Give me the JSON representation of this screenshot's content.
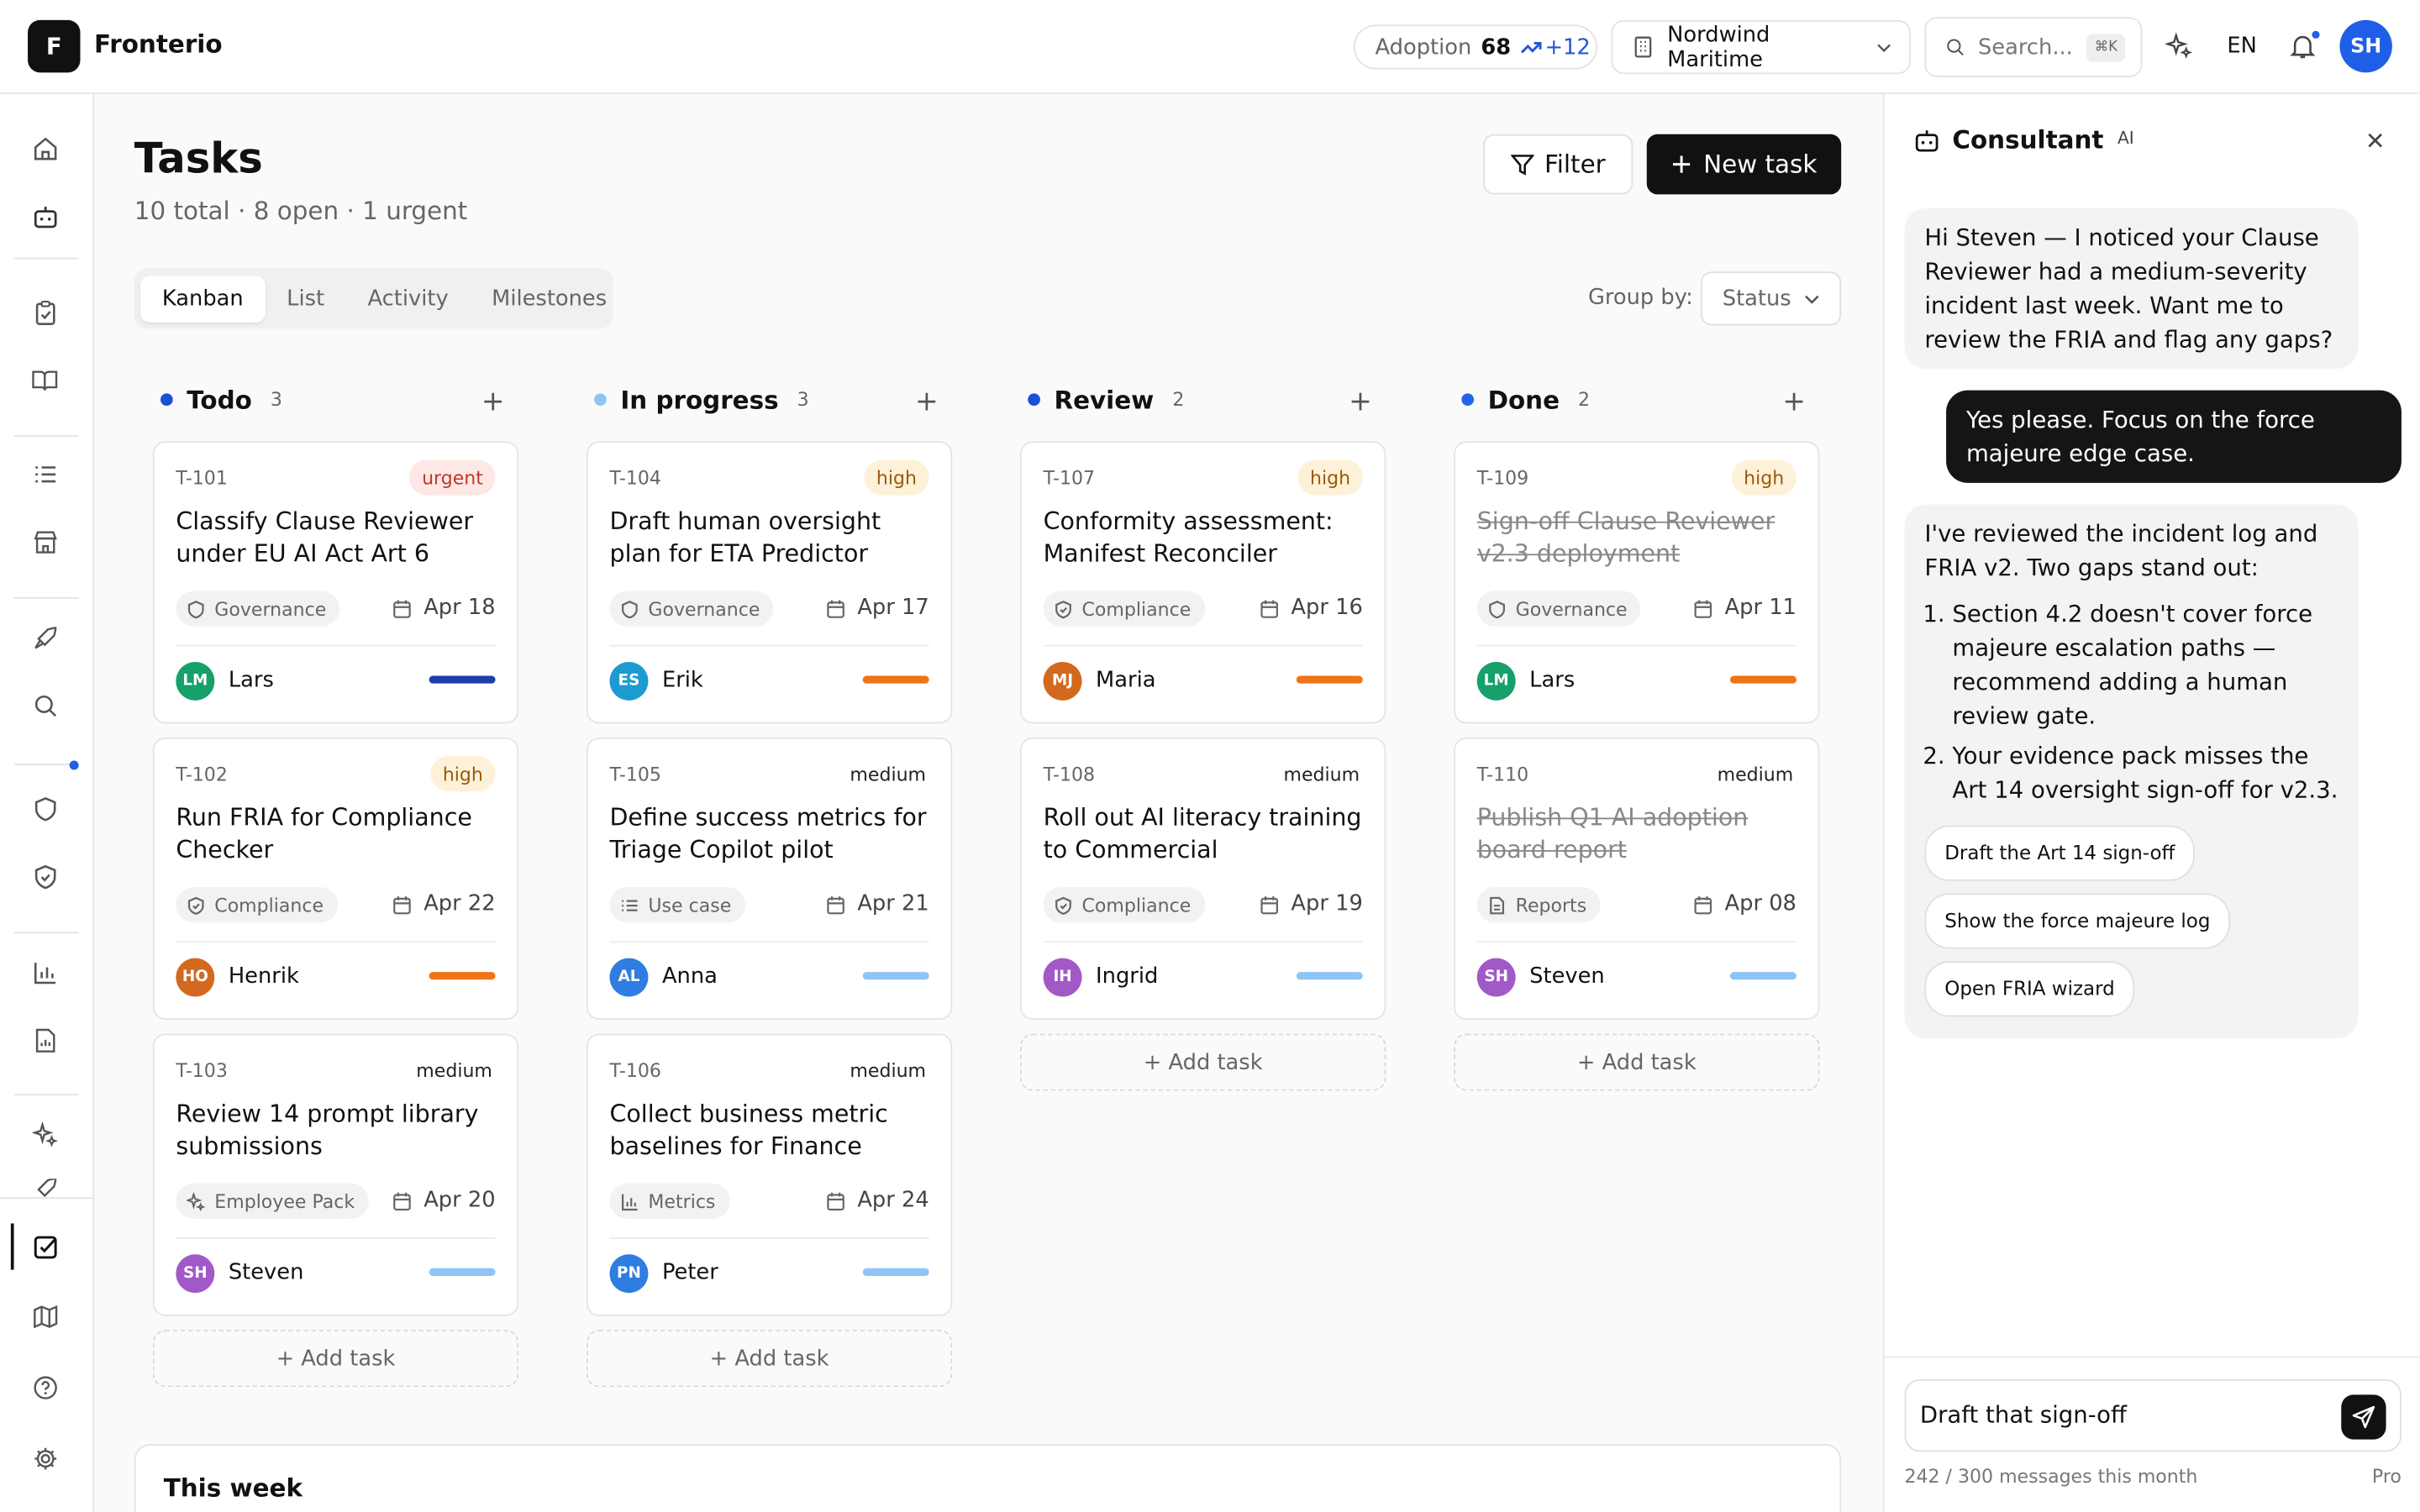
{
  "header": {
    "logo_letter": "F",
    "app_name": "Fronterio",
    "adoption_label": "Adoption",
    "adoption_value": "68",
    "adoption_delta": "+12",
    "org_name": "Nordwind Maritime",
    "search_placeholder": "Search...",
    "search_shortcut": "⌘K",
    "language": "EN",
    "user_initials": "SH"
  },
  "page": {
    "title": "Tasks",
    "subtitle": "10 total · 8 open · 1 urgent",
    "filter_label": "Filter",
    "new_task_label": "New task",
    "tabs": [
      "Kanban",
      "List",
      "Activity",
      "Milestones"
    ],
    "active_tab": "Kanban",
    "group_by_label": "Group by:",
    "group_by_value": "Status",
    "add_task_label": "+ Add task",
    "this_week_label": "This week"
  },
  "columns": [
    {
      "title": "Todo",
      "count": "3",
      "dot_color": "#1d4ed8",
      "cards": [
        {
          "id": "T-101",
          "priority": "urgent",
          "title": "Classify Clause Reviewer under EU AI Act Art 6",
          "tag": "Governance",
          "tag_icon": "shield-icon",
          "due": "Apr 18",
          "initials": "LM",
          "assignee": "Lars",
          "avatar_color": "#16a06a",
          "bar_color": "#1e3ea8",
          "done": false
        },
        {
          "id": "T-102",
          "priority": "high",
          "title": "Run FRIA for Compliance Checker",
          "tag": "Compliance",
          "tag_icon": "shield-check-icon",
          "due": "Apr 22",
          "initials": "HO",
          "assignee": "Henrik",
          "avatar_color": "#d2691e",
          "bar_color": "#f07318",
          "done": false
        },
        {
          "id": "T-103",
          "priority": "medium",
          "title": "Review 14 prompt library submissions",
          "tag": "Employee Pack",
          "tag_icon": "sparkle-icon",
          "due": "Apr 20",
          "initials": "SH",
          "assignee": "Steven",
          "avatar_color": "#a259c8",
          "bar_color": "#8ec5f5",
          "done": false
        }
      ]
    },
    {
      "title": "In progress",
      "count": "3",
      "dot_color": "#8ec5f5",
      "cards": [
        {
          "id": "T-104",
          "priority": "high",
          "title": "Draft human oversight plan for ETA Predictor",
          "tag": "Governance",
          "tag_icon": "shield-icon",
          "due": "Apr 17",
          "initials": "ES",
          "assignee": "Erik",
          "avatar_color": "#1d9bd1",
          "bar_color": "#f07318",
          "done": false
        },
        {
          "id": "T-105",
          "priority": "medium",
          "title": "Define success metrics for Triage Copilot pilot",
          "tag": "Use case",
          "tag_icon": "list-icon",
          "due": "Apr 21",
          "initials": "AL",
          "assignee": "Anna",
          "avatar_color": "#2f7de0",
          "bar_color": "#8ec5f5",
          "done": false
        },
        {
          "id": "T-106",
          "priority": "medium",
          "title": "Collect business metric baselines for Finance",
          "tag": "Metrics",
          "tag_icon": "bar-chart-icon",
          "due": "Apr 24",
          "initials": "PN",
          "assignee": "Peter",
          "avatar_color": "#2f7de0",
          "bar_color": "#8ec5f5",
          "done": false
        }
      ]
    },
    {
      "title": "Review",
      "count": "2",
      "dot_color": "#1d4ed8",
      "cards": [
        {
          "id": "T-107",
          "priority": "high",
          "title": "Conformity assessment: Manifest Reconciler",
          "tag": "Compliance",
          "tag_icon": "shield-check-icon",
          "due": "Apr 16",
          "initials": "MJ",
          "assignee": "Maria",
          "avatar_color": "#d2691e",
          "bar_color": "#f07318",
          "done": false
        },
        {
          "id": "T-108",
          "priority": "medium",
          "title": "Roll out AI literacy training to Commercial",
          "tag": "Compliance",
          "tag_icon": "shield-check-icon",
          "due": "Apr 19",
          "initials": "IH",
          "assignee": "Ingrid",
          "avatar_color": "#a259c8",
          "bar_color": "#8ec5f5",
          "done": false
        }
      ]
    },
    {
      "title": "Done",
      "count": "2",
      "dot_color": "#2563eb",
      "cards": [
        {
          "id": "T-109",
          "priority": "high",
          "title": "Sign-off Clause Reviewer v2.3 deployment",
          "tag": "Governance",
          "tag_icon": "shield-icon",
          "due": "Apr 11",
          "initials": "LM",
          "assignee": "Lars",
          "avatar_color": "#16a06a",
          "bar_color": "#f07318",
          "done": true
        },
        {
          "id": "T-110",
          "priority": "medium",
          "title": "Publish Q1 AI adoption board report",
          "tag": "Reports",
          "tag_icon": "file-icon",
          "due": "Apr 08",
          "initials": "SH",
          "assignee": "Steven",
          "avatar_color": "#a259c8",
          "bar_color": "#8ec5f5",
          "done": true
        }
      ]
    }
  ],
  "consultant": {
    "title": "Consultant",
    "badge": "AI",
    "messages": [
      {
        "role": "ai",
        "text": "Hi Steven — I noticed your Clause Reviewer had a medium-severity incident last week. Want me to review the FRIA and flag any gaps?"
      },
      {
        "role": "user",
        "text": "Yes please. Focus on the force majeure edge case."
      },
      {
        "role": "ai",
        "text": "I've reviewed the incident log and FRIA v2. Two gaps stand out:",
        "items": [
          "Section 4.2 doesn't cover force majeure escalation paths — recommend adding a human review gate.",
          "Your evidence pack misses the Art 14 oversight sign-off for v2.3."
        ],
        "chips": [
          "Draft the Art 14 sign-off",
          "Show the force majeure log",
          "Open FRIA wizard"
        ]
      }
    ],
    "composer_value": "Draft that sign-off",
    "quota": "242 / 300 messages this month",
    "plan": "Pro"
  }
}
